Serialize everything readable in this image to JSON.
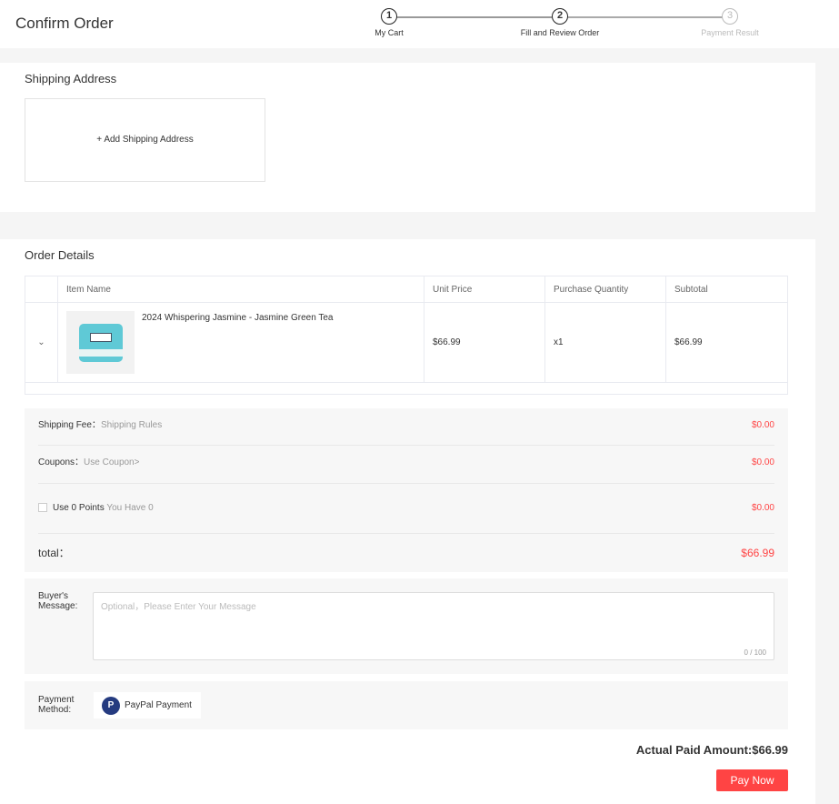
{
  "header": {
    "title": "Confirm Order",
    "steps": [
      {
        "num": "1",
        "label": "My Cart"
      },
      {
        "num": "2",
        "label": "Fill and Review Order"
      },
      {
        "num": "3",
        "label": "Payment Result"
      }
    ]
  },
  "shipping": {
    "title": "Shipping Address",
    "add_label": "+ Add Shipping Address"
  },
  "order": {
    "title": "Order Details",
    "columns": [
      "Item Name",
      "Unit Price",
      "Purchase Quantity",
      "Subtotal"
    ],
    "items": [
      {
        "name": "2024 Whispering Jasmine - Jasmine Green Tea",
        "unit_price": "$66.99",
        "quantity": "x1",
        "subtotal": "$66.99"
      }
    ]
  },
  "summary": {
    "shipping_label": "Shipping Fee：",
    "shipping_link": "Shipping Rules",
    "shipping_value": "$0.00",
    "coupon_label": "Coupons：",
    "coupon_link": "Use Coupon>",
    "coupon_value": "$0.00",
    "points_label": "Use 0 Points",
    "points_have": "You Have 0",
    "points_value": "$0.00",
    "total_label": "total：",
    "total_value": "$66.99"
  },
  "message": {
    "label_1": "Buyer's",
    "label_2": "Message:",
    "placeholder": "Optional，Please Enter Your Message",
    "counter": "0 / 100"
  },
  "payment": {
    "label_1": "Payment",
    "label_2": "Method:",
    "method": "PayPal Payment",
    "logo_text": "PayPal"
  },
  "footer": {
    "actual_paid": "Actual Paid Amount:$66.99",
    "pay_now": "Pay Now"
  },
  "colors": {
    "accent": "#ff4444"
  }
}
